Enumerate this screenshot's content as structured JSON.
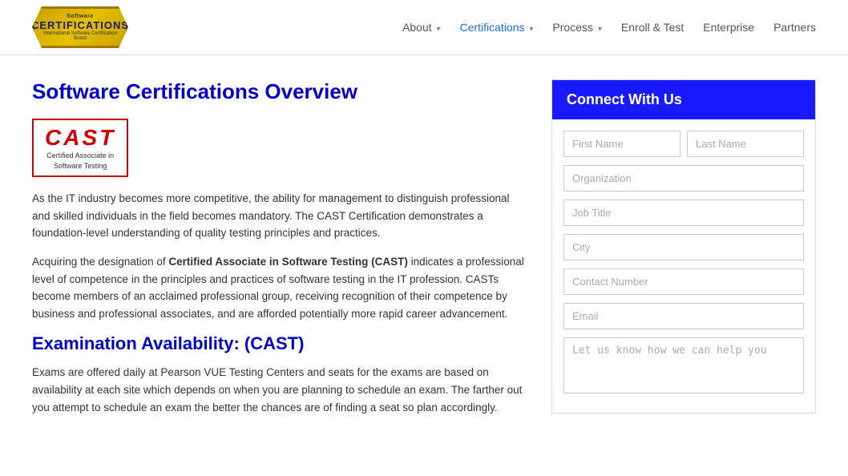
{
  "header": {
    "logo": {
      "top_text": "Software",
      "main_text": "CERTIFICATIONS",
      "sub_text": "International Software Certification Board"
    },
    "nav": [
      {
        "label": "About",
        "active": false,
        "has_dropdown": true
      },
      {
        "label": "Certifications",
        "active": true,
        "has_dropdown": true
      },
      {
        "label": "Process",
        "active": false,
        "has_dropdown": true
      },
      {
        "label": "Enroll & Test",
        "active": false,
        "has_dropdown": false
      },
      {
        "label": "Enterprise",
        "active": false,
        "has_dropdown": false
      },
      {
        "label": "Partners",
        "active": false,
        "has_dropdown": false
      }
    ]
  },
  "content": {
    "page_title": "Software Certifications Overview",
    "cast_logo": {
      "acronym": "CAST",
      "sub_line1": "Certified Associate in",
      "sub_line2": "Software Testing"
    },
    "paragraph1": "As the IT industry becomes more competitive, the ability for management to distinguish professional and skilled individuals in the field becomes mandatory. The CAST Certification demonstrates a foundation-level understanding of quality testing principles and practices.",
    "paragraph2_prefix": "Acquiring the designation of ",
    "paragraph2_bold": "Certified Associate in Software Testing (CAST)",
    "paragraph2_suffix": " indicates a professional level of competence in the principles and practices of software testing in the IT profession. CASTs become members of an acclaimed professional group, receiving recognition of their competence by business and professional associates, and are afforded potentially more rapid career advancement.",
    "exam_title": "Examination Availability: (CAST)",
    "exam_text": "Exams are offered daily at Pearson VUE Testing Centers and seats for the exams are based on availability at each site which depends on when you are planning to schedule an exam. The farther out you attempt to schedule an exam the better the chances are of finding a seat so plan accordingly."
  },
  "sidebar": {
    "connect_header": "Connect With Us",
    "form": {
      "first_name_placeholder": "First Name",
      "last_name_placeholder": "Last Name",
      "organization_placeholder": "Organization",
      "job_title_placeholder": "Job Title",
      "city_placeholder": "City",
      "contact_number_placeholder": "Contact Number",
      "email_placeholder": "Email",
      "message_placeholder": "Let us know how we can help you"
    }
  }
}
